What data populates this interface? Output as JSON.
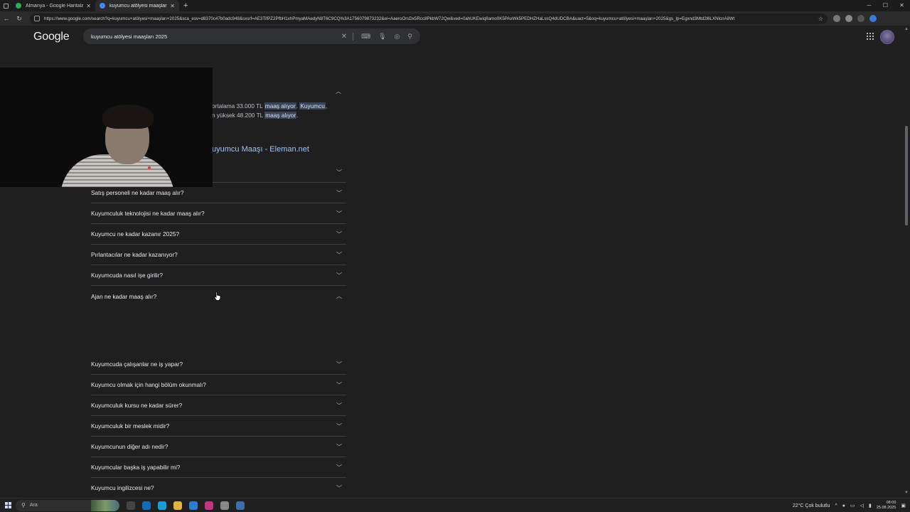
{
  "browser": {
    "tabs": [
      {
        "title": "Almanya - Google Haritalar",
        "active": false,
        "color": "#34a853"
      },
      {
        "title": "kuyumcu atölyesi maaşları 2025",
        "active": true,
        "color": "#4285f4"
      }
    ],
    "url": "https://www.google.com/search?q=kuyumcu+atölyesi+maaşları+2025&sca_esv=d8370c47b0adc948&sxsrf=AE3TifPZ2PfbH1xhPmyaMAedyN8T6C9CQ%3A1756079873232&ei=AaeroOrsDx5Rcc8PkbW72Qw&ved=0ahUKEwiq8amo0K5PAxWk5PEDHZHaLssQ4dUDCBA&uact=5&oq=kuyumcu+atölyesi+maaşları+2025&gs_lp=Egxnd3Mtd2l6LXNlcnAiIWt"
  },
  "google": {
    "logo": "Google",
    "search_query": "kuyumcu atölyesi maaşları 2025"
  },
  "snippet": {
    "line1_pre": "ortalama 33.000 TL ",
    "line1_hl1": "maaş alıyor",
    "line1_mid": ". ",
    "line1_hl2": "Kuyumcu",
    "line1_post": ",",
    "line2_pre": "n yüksek 48.200 TL ",
    "line2_hl": "maaş alıyor",
    "line2_post": ".",
    "link": "uyumcu Maaşı - Eleman.net"
  },
  "paa": [
    {
      "question": "",
      "expanded": false
    },
    {
      "question": "Satış personeli ne kadar maaş alır?",
      "expanded": false
    },
    {
      "question": "Kuyumculuk teknolojisi ne kadar maaş alır?",
      "expanded": false
    },
    {
      "question": "Kuyumcu ne kadar kazanır 2025?",
      "expanded": false
    },
    {
      "question": "Pırlantacılar ne kadar kazanıyor?",
      "expanded": false
    },
    {
      "question": "Kuyumcuda nasıl işe girilir?",
      "expanded": false
    },
    {
      "question": "Ajan ne kadar maaş alır?",
      "expanded": true
    },
    {
      "question": "Kuyumcuda çalışanlar ne iş yapar?",
      "expanded": false
    },
    {
      "question": "Kuyumcu olmak için hangi bölüm okunmalı?",
      "expanded": false
    },
    {
      "question": "Kuyumculuk kursu ne kadar sürer?",
      "expanded": false
    },
    {
      "question": "Kuyumculuk bir meslek midir?",
      "expanded": false
    },
    {
      "question": "Kuyumcunun diğer adı nedir?",
      "expanded": false
    },
    {
      "question": "Kuyumcular başka iş yapabilir mi?",
      "expanded": false
    },
    {
      "question": "Kuyumcu ingilizcesi ne?",
      "expanded": false
    }
  ],
  "taskbar": {
    "search_placeholder": "Ara",
    "weather": "22°C  Çok bulutlu",
    "time": "08:00",
    "date": "25.08.2025"
  }
}
